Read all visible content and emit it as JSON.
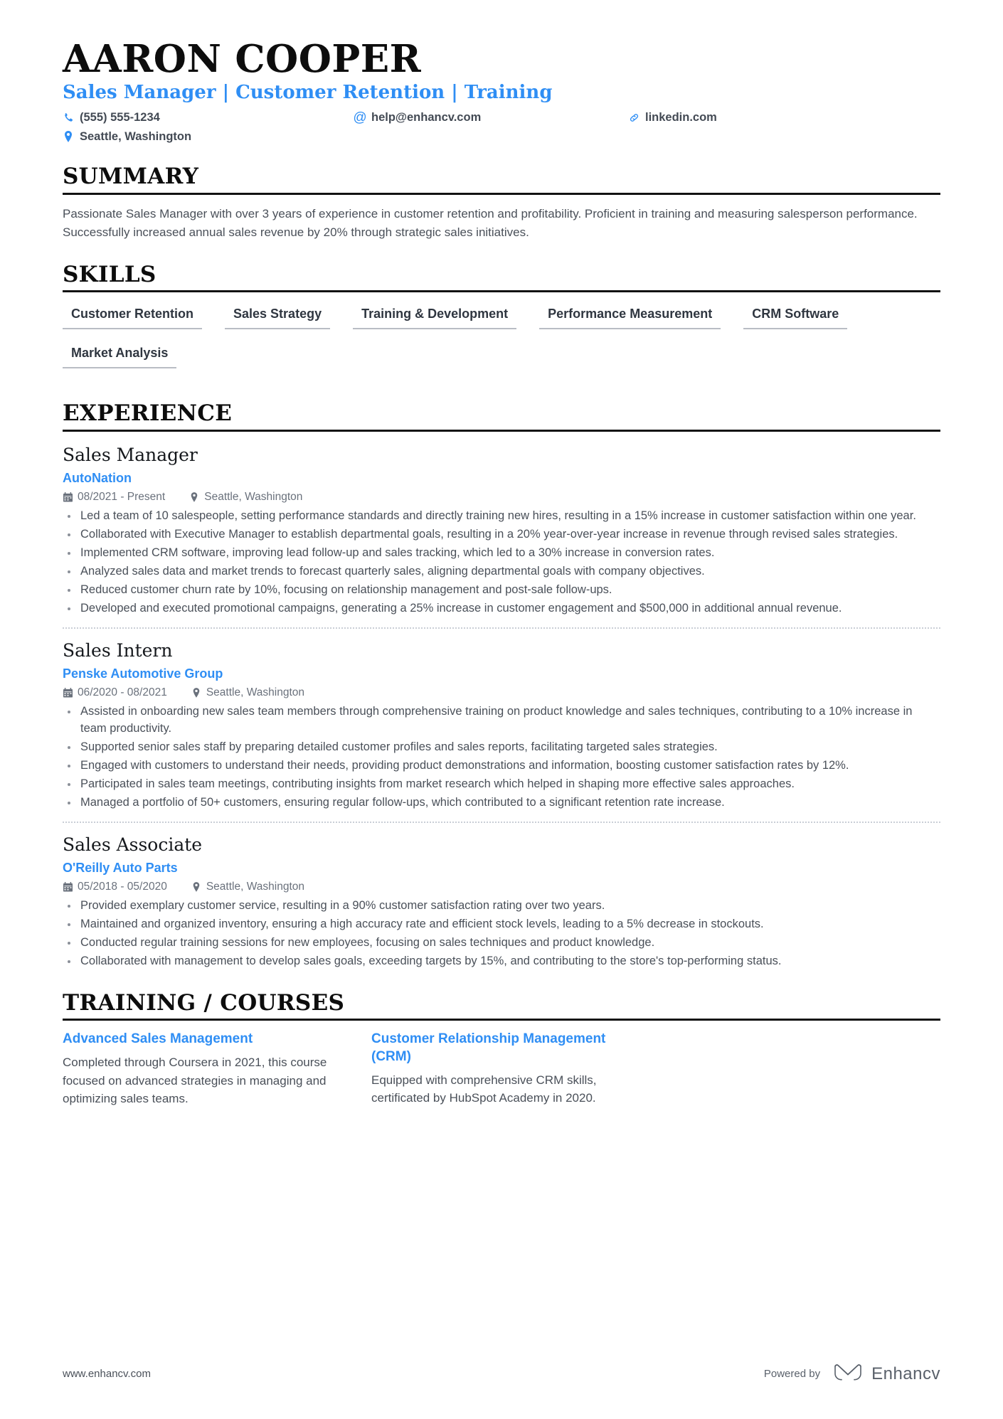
{
  "header": {
    "name": "AARON COOPER",
    "headline": "Sales Manager | Customer Retention | Training",
    "contacts": [
      {
        "icon": "phone-icon",
        "text": "(555) 555-1234"
      },
      {
        "icon": "email-icon",
        "text": "help@enhancv.com"
      },
      {
        "icon": "link-icon",
        "text": "linkedin.com"
      },
      {
        "icon": "location-icon",
        "text": "Seattle, Washington"
      }
    ]
  },
  "summary": {
    "title": "SUMMARY",
    "text": "Passionate Sales Manager with over 3 years of experience in customer retention and profitability. Proficient in training and measuring salesperson performance. Successfully increased annual sales revenue by 20% through strategic sales initiatives."
  },
  "skills": {
    "title": "SKILLS",
    "items": [
      "Customer Retention",
      "Sales Strategy",
      "Training & Development",
      "Performance Measurement",
      "CRM Software",
      "Market Analysis"
    ]
  },
  "experience": {
    "title": "EXPERIENCE",
    "jobs": [
      {
        "title": "Sales Manager",
        "company": "AutoNation",
        "dates": "08/2021 - Present",
        "location": "Seattle, Washington",
        "bullets": [
          "Led a team of 10 salespeople, setting performance standards and directly training new hires, resulting in a 15% increase in customer satisfaction within one year.",
          "Collaborated with Executive Manager to establish departmental goals, resulting in a 20% year-over-year increase in revenue through revised sales strategies.",
          "Implemented CRM software, improving lead follow-up and sales tracking, which led to a 30% increase in conversion rates.",
          "Analyzed sales data and market trends to forecast quarterly sales, aligning departmental goals with company objectives.",
          "Reduced customer churn rate by 10%, focusing on relationship management and post-sale follow-ups.",
          "Developed and executed promotional campaigns, generating a 25% increase in customer engagement and $500,000 in additional annual revenue."
        ]
      },
      {
        "title": "Sales Intern",
        "company": "Penske Automotive Group",
        "dates": "06/2020 - 08/2021",
        "location": "Seattle, Washington",
        "bullets": [
          "Assisted in onboarding new sales team members through comprehensive training on product knowledge and sales techniques, contributing to a 10% increase in team productivity.",
          "Supported senior sales staff by preparing detailed customer profiles and sales reports, facilitating targeted sales strategies.",
          "Engaged with customers to understand their needs, providing product demonstrations and information, boosting customer satisfaction rates by 12%.",
          "Participated in sales team meetings, contributing insights from market research which helped in shaping more effective sales approaches.",
          "Managed a portfolio of 50+ customers, ensuring regular follow-ups, which contributed to a significant retention rate increase."
        ]
      },
      {
        "title": "Sales Associate",
        "company": "O'Reilly Auto Parts",
        "dates": "05/2018 - 05/2020",
        "location": "Seattle, Washington",
        "bullets": [
          "Provided exemplary customer service, resulting in a 90% customer satisfaction rating over two years.",
          "Maintained and organized inventory, ensuring a high accuracy rate and efficient stock levels, leading to a 5% decrease in stockouts.",
          "Conducted regular training sessions for new employees, focusing on sales techniques and product knowledge.",
          "Collaborated with management to develop sales goals, exceeding targets by 15%, and contributing to the store's top-performing status."
        ]
      }
    ]
  },
  "training": {
    "title": "TRAINING / COURSES",
    "courses": [
      {
        "name": "Advanced Sales Management",
        "description": "Completed through Coursera in 2021, this course focused on advanced strategies in managing and optimizing sales teams."
      },
      {
        "name": "Customer Relationship Management (CRM)",
        "description": "Equipped with comprehensive CRM skills, certificated by HubSpot Academy in 2020."
      }
    ]
  },
  "footer": {
    "url": "www.enhancv.com",
    "powered_by": "Powered by",
    "brand": "Enhancv"
  },
  "colors": {
    "accent": "#2f8ef4",
    "ink": "#0d0d0d",
    "body": "#4a5059",
    "muted": "#6a717c"
  }
}
